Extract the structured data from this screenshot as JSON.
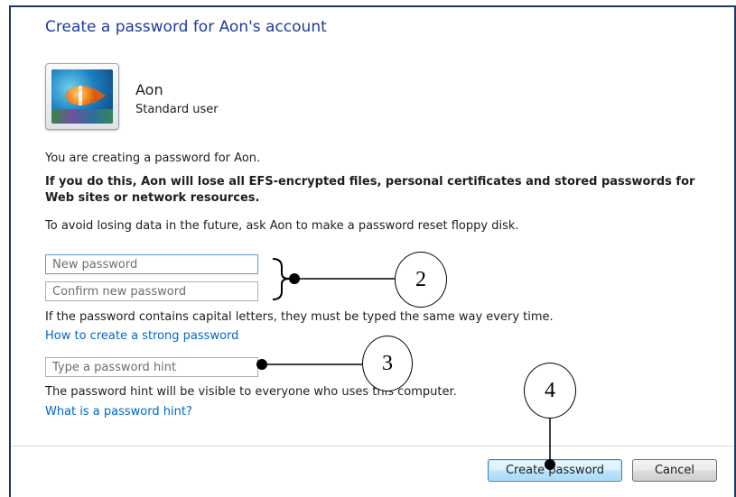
{
  "dialog": {
    "title": "Create a password for Aon's account",
    "user": {
      "name": "Aon",
      "account_type": "Standard user"
    },
    "intro": "You are creating a password for Aon.",
    "warning": "If you do this, Aon will lose all EFS-encrypted files, personal certificates and stored passwords for Web sites or network resources.",
    "advice": "To avoid losing data in the future, ask Aon to make a password reset floppy disk.",
    "fields": {
      "new_password": {
        "placeholder": "New password",
        "value": ""
      },
      "confirm_password": {
        "placeholder": "Confirm new password",
        "value": ""
      },
      "hint": {
        "placeholder": "Type a password hint",
        "value": ""
      }
    },
    "case_note": "If the password contains capital letters, they must be typed the same way every time.",
    "strong_link": "How to create a strong password",
    "hint_note": "The password hint will be visible to everyone who uses this computer.",
    "hint_link": "What is a password hint?",
    "buttons": {
      "create": "Create password",
      "cancel": "Cancel"
    }
  },
  "annotations": {
    "callout_2": "2",
    "callout_3": "3",
    "callout_4": "4"
  },
  "colors": {
    "title": "#1e3b9e",
    "link": "#0066cc",
    "frame": "#1f3864"
  },
  "icons": {
    "user_picture": "fish-picture"
  }
}
